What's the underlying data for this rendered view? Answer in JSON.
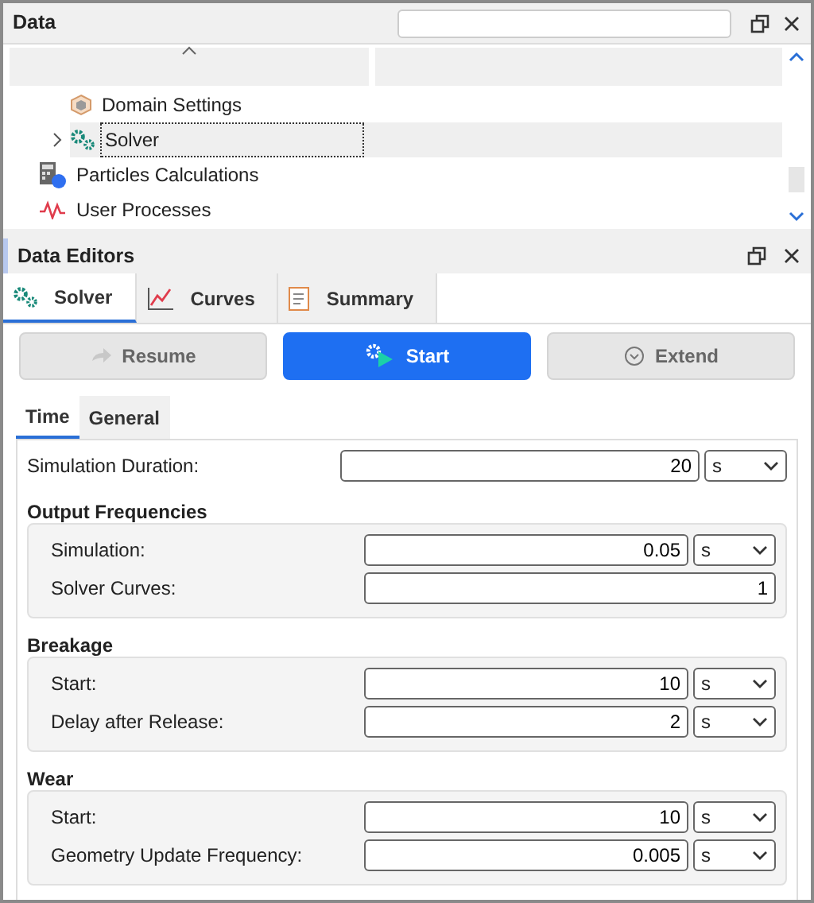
{
  "data_panel": {
    "title": "Data",
    "tree": [
      {
        "children": [
          {
            "label": "Domain Settings",
            "kind": "cube",
            "selected": false
          },
          {
            "label": "Solver",
            "kind": "gears",
            "selected": true,
            "expanded": false
          }
        ]
      },
      {
        "label": "Particles Calculations",
        "kind": "calculator",
        "selected": false
      },
      {
        "label": "User Processes",
        "kind": "wave",
        "selected": false
      }
    ]
  },
  "editors_panel": {
    "title": "Data Editors",
    "tabs": [
      {
        "label": "Solver",
        "kind": "gears",
        "selected": true
      },
      {
        "label": "Curves",
        "kind": "chart",
        "selected": false
      },
      {
        "label": "Summary",
        "kind": "document",
        "selected": false
      }
    ],
    "buttons": [
      {
        "label": "Resume",
        "kind": "resume",
        "primary": false,
        "disabled": true
      },
      {
        "label": "Start",
        "kind": "start",
        "primary": true,
        "disabled": false
      },
      {
        "label": "Extend",
        "kind": "extend",
        "primary": false,
        "disabled": true
      }
    ],
    "subtabs": [
      {
        "label": "Time",
        "selected": true
      },
      {
        "label": "General",
        "selected": false
      }
    ],
    "fields": [
      {
        "label": "Simulation Duration:",
        "value": "20",
        "unit": "s"
      }
    ],
    "groups": [
      {
        "title": "Output Frequencies",
        "fields": [
          {
            "label": "Simulation:",
            "value": "0.05",
            "unit": "s"
          },
          {
            "label": "Solver Curves:",
            "value": "1"
          }
        ]
      },
      {
        "title": "Breakage",
        "fields": [
          {
            "label": "Start:",
            "value": "10",
            "unit": "s"
          },
          {
            "label": "Delay after Release:",
            "value": "2",
            "unit": "s"
          }
        ]
      },
      {
        "title": "Wear",
        "fields": [
          {
            "label": "Start:",
            "value": "10",
            "unit": "s"
          },
          {
            "label": "Geometry Update Frequency:",
            "value": "0.005",
            "unit": "s"
          }
        ]
      }
    ]
  }
}
